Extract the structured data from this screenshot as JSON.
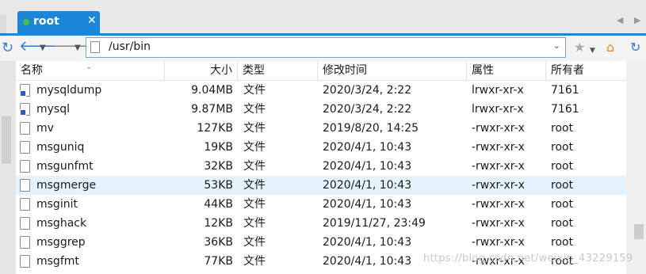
{
  "tab": {
    "title": "root",
    "close": "✕"
  },
  "toolbar": {
    "back_icon": "arrow-left-icon",
    "forward_icon": "arrow-right-icon",
    "path": "/usr/bin"
  },
  "columns": {
    "name": "名称",
    "size": "大小",
    "type": "类型",
    "modified": "修改时间",
    "perms": "属性",
    "owner": "所有者"
  },
  "files": [
    {
      "name": "mysqldump",
      "size": "9.04MB",
      "type": "文件",
      "modified": "2020/3/24, 2:22",
      "perms": "lrwxr-xr-x",
      "owner": "7161",
      "link": true
    },
    {
      "name": "mysql",
      "size": "9.87MB",
      "type": "文件",
      "modified": "2020/3/24, 2:22",
      "perms": "lrwxr-xr-x",
      "owner": "7161",
      "link": true
    },
    {
      "name": "mv",
      "size": "127KB",
      "type": "文件",
      "modified": "2019/8/20, 14:25",
      "perms": "-rwxr-xr-x",
      "owner": "root",
      "link": false
    },
    {
      "name": "msguniq",
      "size": "19KB",
      "type": "文件",
      "modified": "2020/4/1, 10:43",
      "perms": "-rwxr-xr-x",
      "owner": "root",
      "link": false
    },
    {
      "name": "msgunfmt",
      "size": "32KB",
      "type": "文件",
      "modified": "2020/4/1, 10:43",
      "perms": "-rwxr-xr-x",
      "owner": "root",
      "link": false
    },
    {
      "name": "msgmerge",
      "size": "53KB",
      "type": "文件",
      "modified": "2020/4/1, 10:43",
      "perms": "-rwxr-xr-x",
      "owner": "root",
      "link": false,
      "selected": true
    },
    {
      "name": "msginit",
      "size": "44KB",
      "type": "文件",
      "modified": "2020/4/1, 10:43",
      "perms": "-rwxr-xr-x",
      "owner": "root",
      "link": false
    },
    {
      "name": "msghack",
      "size": "12KB",
      "type": "文件",
      "modified": "2019/11/27, 23:49",
      "perms": "-rwxr-xr-x",
      "owner": "root",
      "link": false
    },
    {
      "name": "msggrep",
      "size": "36KB",
      "type": "文件",
      "modified": "2020/4/1, 10:43",
      "perms": "-rwxr-xr-x",
      "owner": "root",
      "link": false
    },
    {
      "name": "msgfmt",
      "size": "77KB",
      "type": "文件",
      "modified": "2020/4/1, 10:43",
      "perms": "-rwxr-xr-x",
      "owner": "root",
      "link": false
    }
  ],
  "watermark": "https://blog.csdn.net/weixin_43229159",
  "colors": {
    "accent": "#1c87d9",
    "selected_row": "#e5f3ff",
    "status_dot": "#3ec43e"
  }
}
